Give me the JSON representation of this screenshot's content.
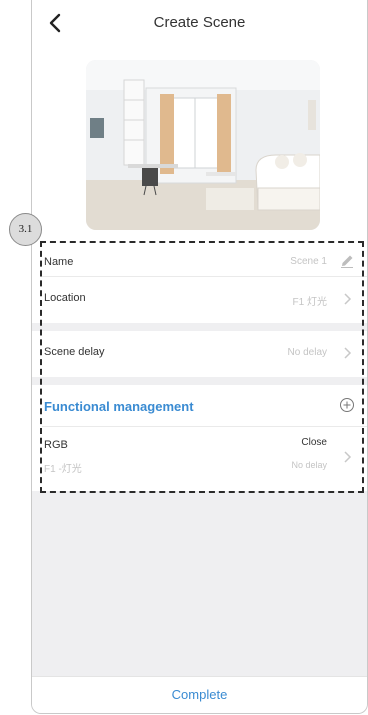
{
  "header": {
    "title": "Create Scene",
    "back_icon": "back-arrow-icon"
  },
  "badge": {
    "label": "3.1"
  },
  "scene": {
    "name": {
      "label": "Name",
      "value": "Scene 1",
      "icon": "pencil-icon"
    },
    "location": {
      "label": "Location",
      "value": "F1 灯光"
    },
    "delay": {
      "label": "Scene delay",
      "value": "No delay"
    }
  },
  "functional": {
    "title": "Functional management",
    "add_icon": "plus-circle-icon",
    "items": [
      {
        "name": "RGB",
        "sub": "F1 -灯光",
        "state": "Close",
        "delay": "No delay"
      }
    ]
  },
  "footer": {
    "complete_label": "Complete"
  },
  "colors": {
    "accent": "#3a8bd2",
    "muted": "#c4c4c4",
    "background": "#efeff1"
  }
}
